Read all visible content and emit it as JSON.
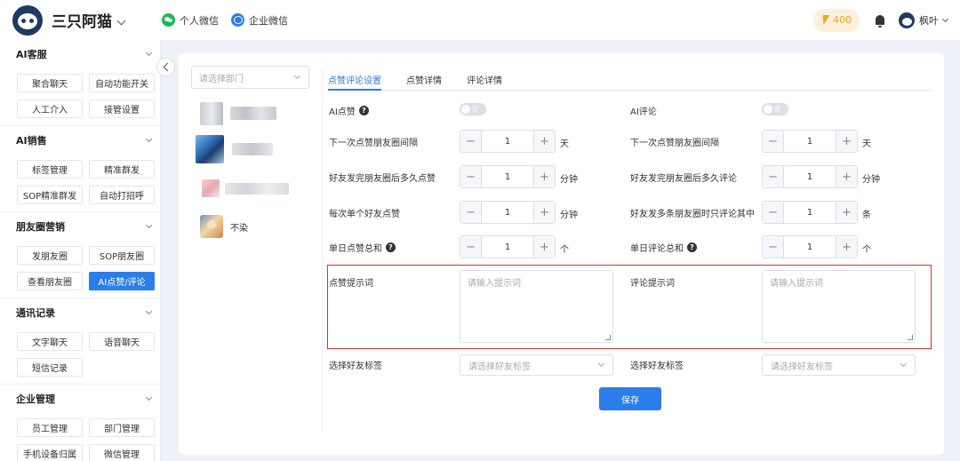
{
  "app": {
    "brand": "三只阿猫",
    "personal_wechat": "个人微信",
    "enterprise_wechat": "企业微信",
    "credits": "400",
    "user_name": "枫叶"
  },
  "sidebar": {
    "sections": [
      {
        "title": "AI客服",
        "items": [
          "聚合聊天",
          "自动功能开关",
          "人工介入",
          "接管设置"
        ]
      },
      {
        "title": "AI销售",
        "items": [
          "标签管理",
          "精准群发",
          "SOP精准群发",
          "自动打招呼"
        ]
      },
      {
        "title": "朋友圈营销",
        "items": [
          "发朋友圈",
          "SOP朋友圈",
          "查看朋友圈",
          "AI点赞/评论"
        ]
      },
      {
        "title": "通讯记录",
        "items": [
          "文字聊天",
          "语音聊天",
          "短信记录"
        ]
      },
      {
        "title": "企业管理",
        "items": [
          "员工管理",
          "部门管理",
          "手机设备归属",
          "微信管理"
        ]
      }
    ],
    "active_item": "AI点赞/评论"
  },
  "left_panel": {
    "dept_placeholder": "请选择部门",
    "contact_name": "不染"
  },
  "tabs": [
    "点赞评论设置",
    "点赞详情",
    "评论详情"
  ],
  "settings": {
    "ai_like": {
      "label": "AI点赞",
      "toggle": "否"
    },
    "ai_comment": {
      "label": "AI评论",
      "toggle": "否"
    },
    "rows": [
      {
        "left_label": "下一次点赞朋友圈间隔",
        "left_value": "1",
        "left_unit": "天",
        "right_label": "下一次点赞朋友圈间隔",
        "right_value": "1",
        "right_unit": "天"
      },
      {
        "left_label": "好友发完朋友圈后多久点赞",
        "left_value": "1",
        "left_unit": "分钟",
        "right_label": "好友发完朋友圈后多久评论",
        "right_value": "1",
        "right_unit": "分钟"
      },
      {
        "left_label": "每次单个好友点赞",
        "left_value": "1",
        "left_unit": "分钟",
        "right_label": "好友发多条朋友圈时只评论其中",
        "right_value": "1",
        "right_unit": "条"
      },
      {
        "left_label": "单日点赞总和",
        "left_value": "1",
        "left_unit": "个",
        "right_label": "单日评论总和",
        "right_value": "1",
        "right_unit": "个"
      }
    ],
    "like_prompt": {
      "label": "点赞提示词",
      "placeholder": "请输入提示词"
    },
    "comment_prompt": {
      "label": "评论提示词",
      "placeholder": "请输入提示词"
    },
    "left_tag": {
      "label": "选择好友标签",
      "placeholder": "请选择好友标签"
    },
    "right_tag": {
      "label": "选择好友标签",
      "placeholder": "请选择好友标签"
    },
    "save_label": "保存"
  },
  "colors": {
    "primary": "#2b7de9",
    "highlight": "#e02f2f",
    "credits_text": "#f0a12b"
  }
}
